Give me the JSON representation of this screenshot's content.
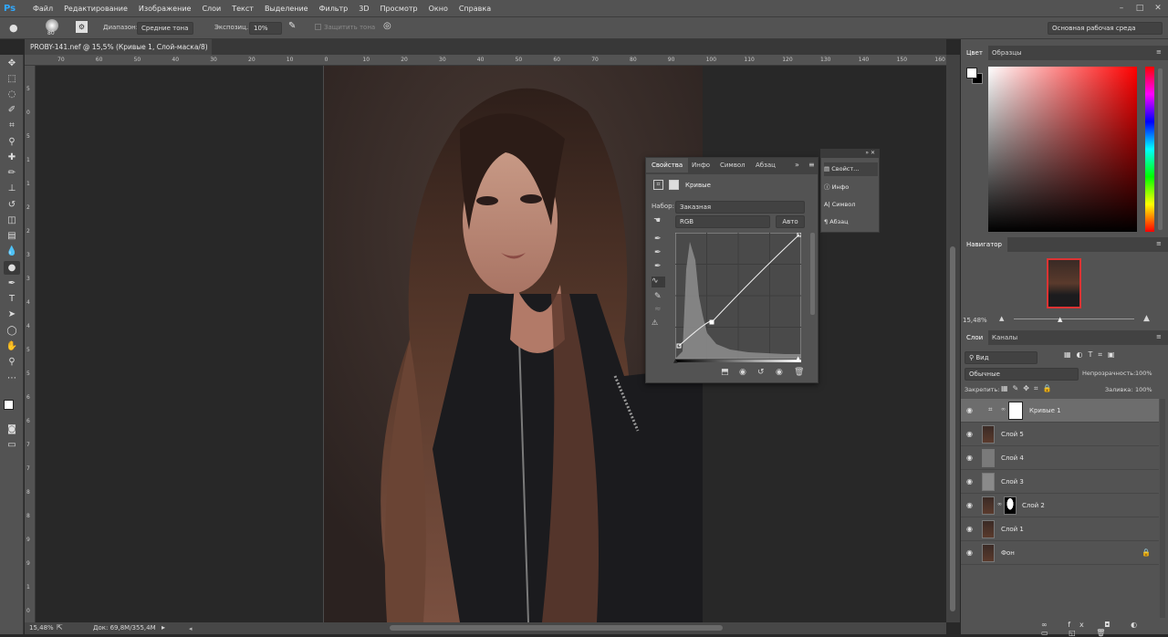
{
  "app": {
    "logo": "Ps"
  },
  "menu": [
    "Файл",
    "Редактирование",
    "Изображение",
    "Слои",
    "Текст",
    "Выделение",
    "Фильтр",
    "3D",
    "Просмотр",
    "Окно",
    "Справка"
  ],
  "options": {
    "brush_size": "80",
    "range_label": "Диапазон:",
    "range_value": "Средние тона",
    "exposure_label": "Экспозиц.:",
    "exposure_value": "10%",
    "protect_tones": "Защитить тона",
    "workspace": "Основная рабочая среда"
  },
  "document": {
    "tab_title": "PROBY-141.nef @ 15,5% (Кривые 1, Слой-маска/8) *"
  },
  "ruler_top": [
    "70",
    "60",
    "50",
    "40",
    "30",
    "20",
    "10",
    "0",
    "10",
    "20",
    "30",
    "40",
    "50",
    "60",
    "70",
    "80",
    "90",
    "100",
    "110",
    "120",
    "130",
    "140",
    "150",
    "160"
  ],
  "ruler_left": [
    "5",
    "0",
    "5",
    "1",
    "1",
    "2",
    "2",
    "3",
    "3",
    "4",
    "4",
    "5",
    "5",
    "6",
    "6",
    "7",
    "7",
    "8",
    "8",
    "9",
    "9",
    "1",
    "0"
  ],
  "status": {
    "zoom": "15,48%",
    "doc": "Док: 69,8M/355,4M"
  },
  "properties": {
    "tabs": [
      "Свойства",
      "Инфо",
      "Символ",
      "Абзац"
    ],
    "title": "Кривые",
    "preset_label": "Набор:",
    "preset_value": "Заказная",
    "channel": "RGB",
    "auto_button": "Авто"
  },
  "collapsed_panel": [
    "Свойст...",
    "Инфо",
    "Символ",
    "Абзац"
  ],
  "color_panel": {
    "tabs": [
      "Цвет",
      "Образцы"
    ],
    "hue_color": "#ff0000"
  },
  "navigator": {
    "title": "Навигатор",
    "zoom": "15,48%"
  },
  "layers_panel": {
    "tabs": [
      "Слои",
      "Каналы"
    ],
    "filter": "Вид",
    "blend_mode": "Обычные",
    "opacity_label": "Непрозрачность:",
    "opacity_value": "100%",
    "lock_label": "Закрепить:",
    "fill_label": "Заливка:",
    "fill_value": "100%",
    "layers": [
      {
        "name": "Кривые 1",
        "active": true
      },
      {
        "name": "Слой 5",
        "active": false
      },
      {
        "name": "Слой 4",
        "active": false
      },
      {
        "name": "Слой 3",
        "active": false
      },
      {
        "name": "Слой 2",
        "active": false
      },
      {
        "name": "Слой 1",
        "active": false
      },
      {
        "name": "Фон",
        "active": false
      }
    ]
  }
}
